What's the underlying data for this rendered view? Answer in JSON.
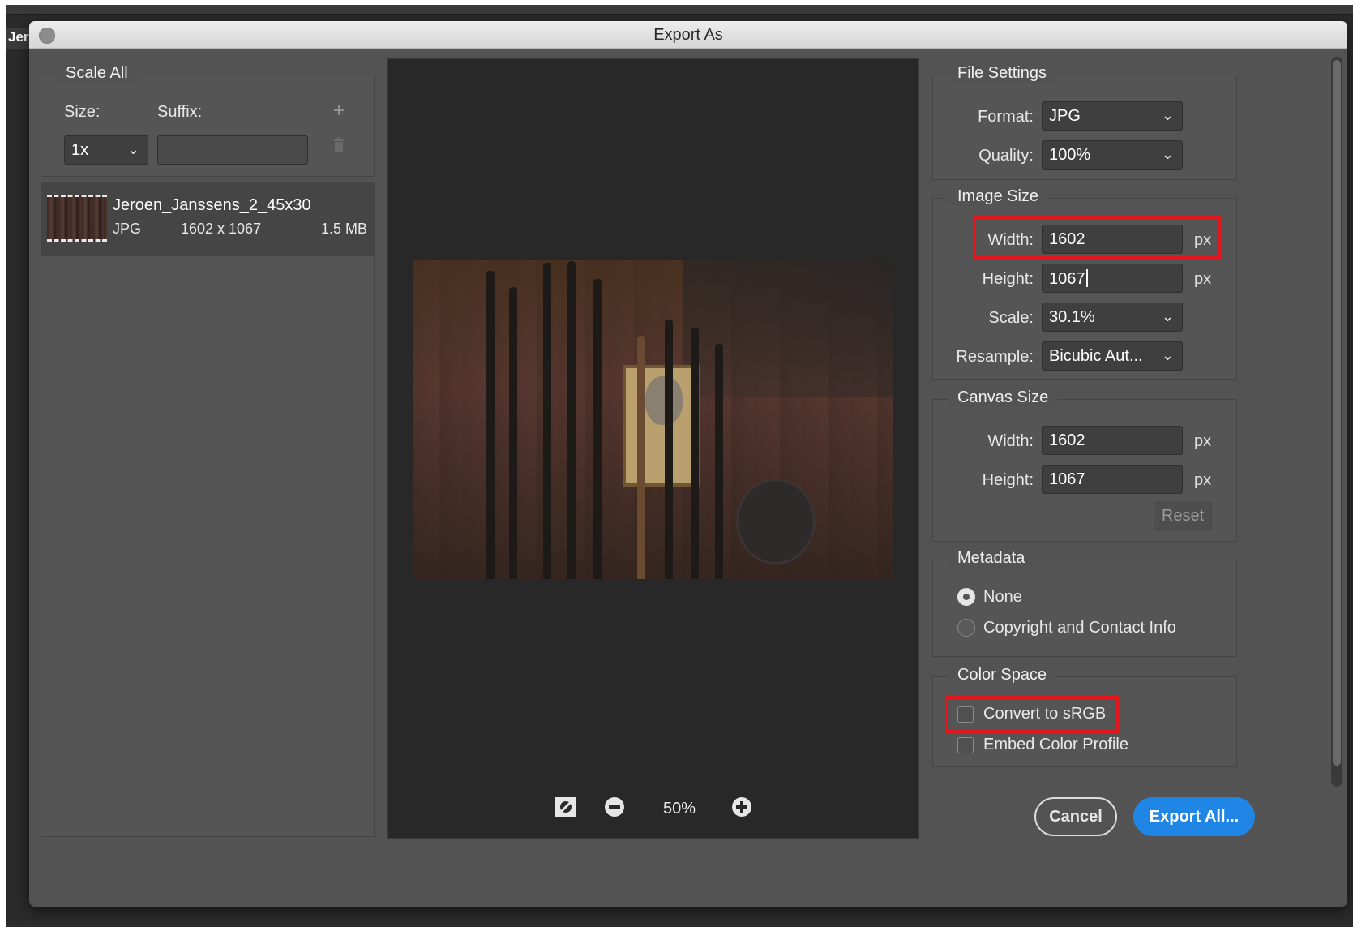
{
  "background_tab": "Jer",
  "dialog": {
    "title": "Export As"
  },
  "scale_all": {
    "legend": "Scale All",
    "size_label": "Size:",
    "suffix_label": "Suffix:",
    "size_value": "1x",
    "suffix_value": "",
    "add_icon": "plus-icon",
    "delete_icon": "trash-icon"
  },
  "file": {
    "name": "Jeroen_Janssens_2_45x30",
    "format": "JPG",
    "dimensions": "1602 x 1067",
    "size": "1.5 MB"
  },
  "preview": {
    "zoom": "50%"
  },
  "file_settings": {
    "legend": "File Settings",
    "format_label": "Format:",
    "format_value": "JPG",
    "quality_label": "Quality:",
    "quality_value": "100%"
  },
  "image_size": {
    "legend": "Image Size",
    "width_label": "Width:",
    "width_value": "1602",
    "height_label": "Height:",
    "height_value": "1067",
    "scale_label": "Scale:",
    "scale_value": "30.1%",
    "resample_label": "Resample:",
    "resample_value": "Bicubic Aut...",
    "unit": "px"
  },
  "canvas_size": {
    "legend": "Canvas Size",
    "width_label": "Width:",
    "width_value": "1602",
    "height_label": "Height:",
    "height_value": "1067",
    "unit": "px",
    "reset_label": "Reset"
  },
  "metadata": {
    "legend": "Metadata",
    "options": [
      "None",
      "Copyright and Contact Info"
    ],
    "selected": "None"
  },
  "color_space": {
    "legend": "Color Space",
    "convert_label": "Convert to sRGB",
    "embed_label": "Embed Color Profile"
  },
  "buttons": {
    "cancel": "Cancel",
    "export": "Export All..."
  },
  "colors": {
    "accent": "#1f86e6",
    "highlight": "#e2161c",
    "dialog_bg": "#535353"
  }
}
